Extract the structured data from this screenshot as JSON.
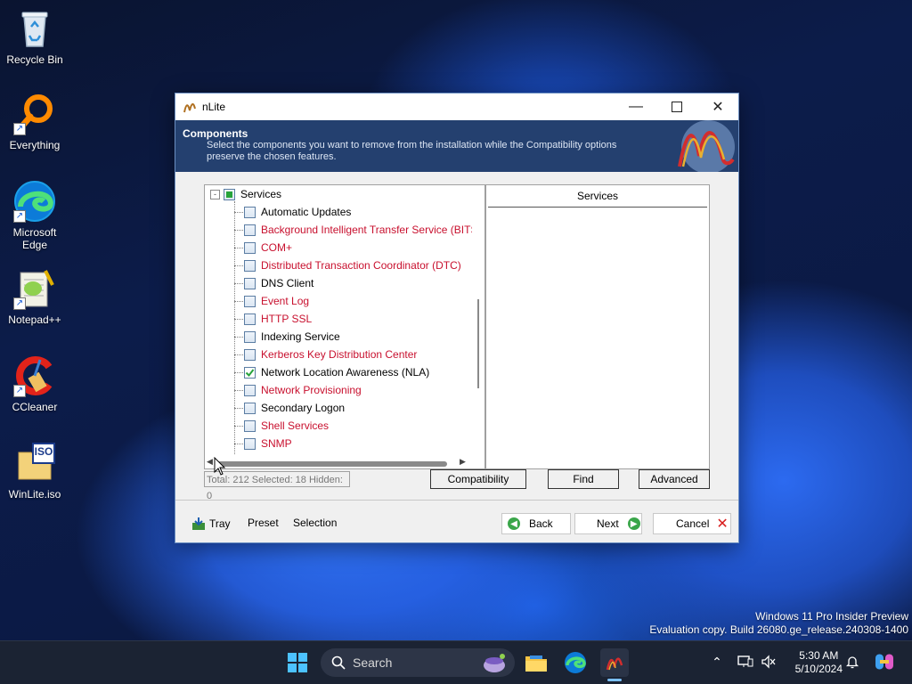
{
  "desktop": {
    "icons": [
      {
        "label": "Recycle Bin"
      },
      {
        "label": "Everything"
      },
      {
        "label": "Microsoft Edge"
      },
      {
        "label": "Notepad++"
      },
      {
        "label": "CCleaner"
      },
      {
        "label": "WinLite.iso",
        "badge": "ISO"
      }
    ],
    "watermark_line1": "Windows 11 Pro Insider Preview",
    "watermark_line2": "Evaluation copy. Build 26080.ge_release.240308-1400"
  },
  "window": {
    "title": "nLite",
    "header_title": "Components",
    "header_desc": "Select the components you want to remove from the installation while the Compatibility options preserve the chosen features.",
    "tree": {
      "group": {
        "label": "Services",
        "state": "partial"
      },
      "items": [
        {
          "label": "Automatic Updates",
          "color": "#000000",
          "checked": false
        },
        {
          "label": "Background Intelligent Transfer Service (BITS)",
          "color": "#c8102e",
          "checked": false
        },
        {
          "label": "COM+",
          "color": "#c8102e",
          "checked": false
        },
        {
          "label": "Distributed Transaction Coordinator (DTC)",
          "color": "#c8102e",
          "checked": false
        },
        {
          "label": "DNS Client",
          "color": "#000000",
          "checked": false
        },
        {
          "label": "Event Log",
          "color": "#c8102e",
          "checked": false
        },
        {
          "label": "HTTP SSL",
          "color": "#c8102e",
          "checked": false
        },
        {
          "label": "Indexing Service",
          "color": "#000000",
          "checked": false
        },
        {
          "label": "Kerberos Key Distribution Center",
          "color": "#c8102e",
          "checked": false
        },
        {
          "label": "Network Location Awareness (NLA)",
          "color": "#000000",
          "checked": true
        },
        {
          "label": "Network Provisioning",
          "color": "#c8102e",
          "checked": false
        },
        {
          "label": "Secondary Logon",
          "color": "#000000",
          "checked": false
        },
        {
          "label": "Shell Services",
          "color": "#c8102e",
          "checked": false
        },
        {
          "label": "SNMP",
          "color": "#c8102e",
          "checked": false
        }
      ]
    },
    "right_panel_header": "Services",
    "status": "Total: 212 Selected: 18 Hidden: 0",
    "buttons": {
      "compatibility": "Compatibility",
      "find": "Find",
      "advanced": "Advanced"
    },
    "bottom": {
      "tray": "Tray",
      "preset": "Preset",
      "selection": "Selection",
      "back": "Back",
      "next": "Next",
      "cancel": "Cancel"
    }
  },
  "taskbar": {
    "search_placeholder": "Search",
    "time": "5:30 AM",
    "date": "5/10/2024"
  },
  "colors": {
    "header_bg": "#24406f",
    "warning_text": "#c8102e",
    "check_green": "#27a33b",
    "taskbar_bg": "#1b2333"
  }
}
